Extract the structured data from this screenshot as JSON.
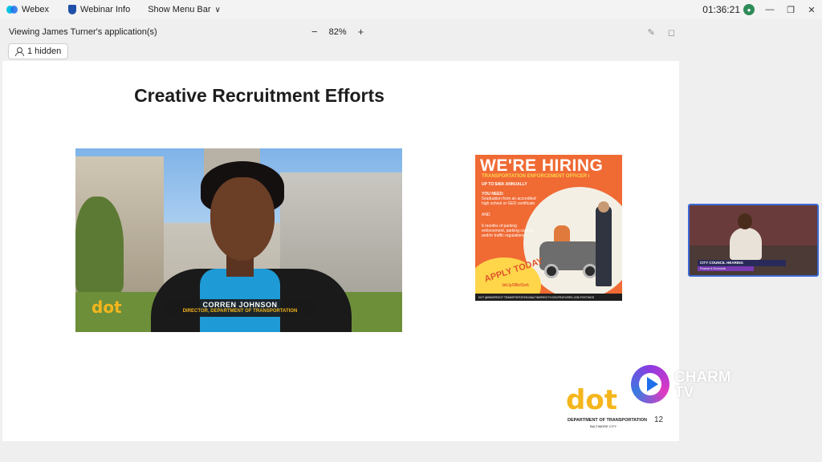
{
  "titlebar": {
    "app_name": "Webex",
    "webinar_info": "Webinar Info",
    "menu_bar": "Show Menu Bar",
    "timer": "01:36:21"
  },
  "share": {
    "title": "Viewing James Turner's application(s)",
    "zoom_minus": "−",
    "zoom_level": "82%",
    "zoom_plus": "+",
    "hidden_label": "1 hidden"
  },
  "slide": {
    "title": "Creative Recruitment Efforts",
    "photo_logo": "dot",
    "lower_third_name": "CORREN JOHNSON",
    "lower_third_role": "DIRECTOR, DEPARTMENT OF TRANSPORTATION",
    "poster": {
      "headline": "WE'RE HIRING",
      "position": "TRANSPORTATION ENFORCEMENT OFFICER I",
      "salary": "UP TO $46K ANNUALLY",
      "you_need": "YOU NEED:",
      "req1": "Graduation from an accredited high school or GED certificate",
      "and": "AND",
      "req2": "6 months of parking enforcement, parking control, and/or traffic regulations",
      "apply": "APPLY TODAY",
      "url": "bit.ly/3Bcf1oh",
      "footer": "DOT  @BMOREDOT  TRANSPORTATION.BALTIMORECITY.GOV/FEATURED-JOB-POSTINGS"
    },
    "footer_logo": "dot",
    "footer_logo_sub": "DEPARTMENT OF TRANSPORTATION",
    "footer_logo_sub2": "BALTIMORE CITY",
    "page_number": "12"
  },
  "camera": {
    "lower_third": "CITY COUNCIL HEARING",
    "lower_third_sub": "Finance & Economic"
  },
  "watermark": {
    "text": "CHARM TV"
  },
  "colors": {
    "accent_blue": "#3d6ad6",
    "dot_yellow": "#f4b61c",
    "poster_orange": "#f06a34"
  }
}
